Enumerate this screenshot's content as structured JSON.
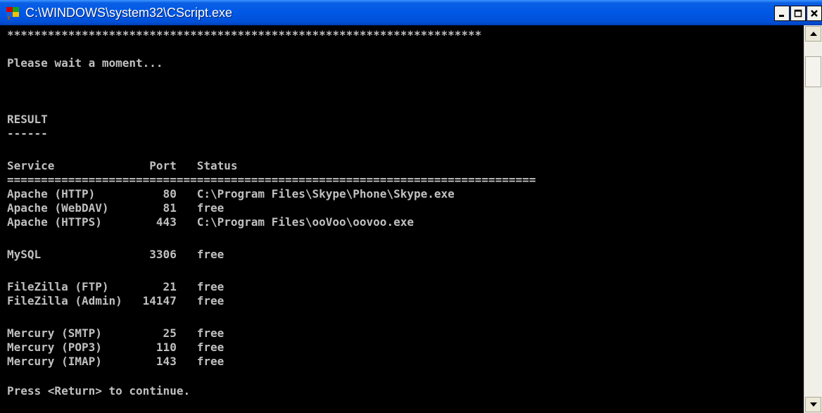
{
  "window": {
    "title": "C:\\WINDOWS\\system32\\CScript.exe",
    "icon": "cscript-icon",
    "controls": {
      "minimize": "minimize-icon",
      "maximize": "maximize-icon",
      "close": "close-icon"
    }
  },
  "console": {
    "lines": [
      "**********************************************************************",
      "",
      "Please wait a moment...",
      "",
      "",
      "RESULT",
      "------",
      "",
      "Service              Port   Status",
      "==============================================================================",
      "Apache (HTTP)          80   C:\\Program Files\\Skype\\Phone\\Skype.exe",
      "Apache (WebDAV)        81   free",
      "Apache (HTTPS)        443   C:\\Program Files\\ooVoo\\oovoo.exe",
      "",
      "MySQL                3306   free",
      "",
      "FileZilla (FTP)        21   free",
      "FileZilla (Admin)   14147   free",
      "",
      "Mercury (SMTP)         25   free",
      "Mercury (POP3)        110   free",
      "Mercury (IMAP)        143   free",
      "",
      "Press <Return> to continue."
    ]
  },
  "scrollbar": {
    "up": "up-arrow-icon",
    "down": "down-arrow-icon"
  },
  "colors": {
    "console_bg": "#000000",
    "console_fg": "#c0c0c0",
    "titlebar": "#0058e6"
  }
}
